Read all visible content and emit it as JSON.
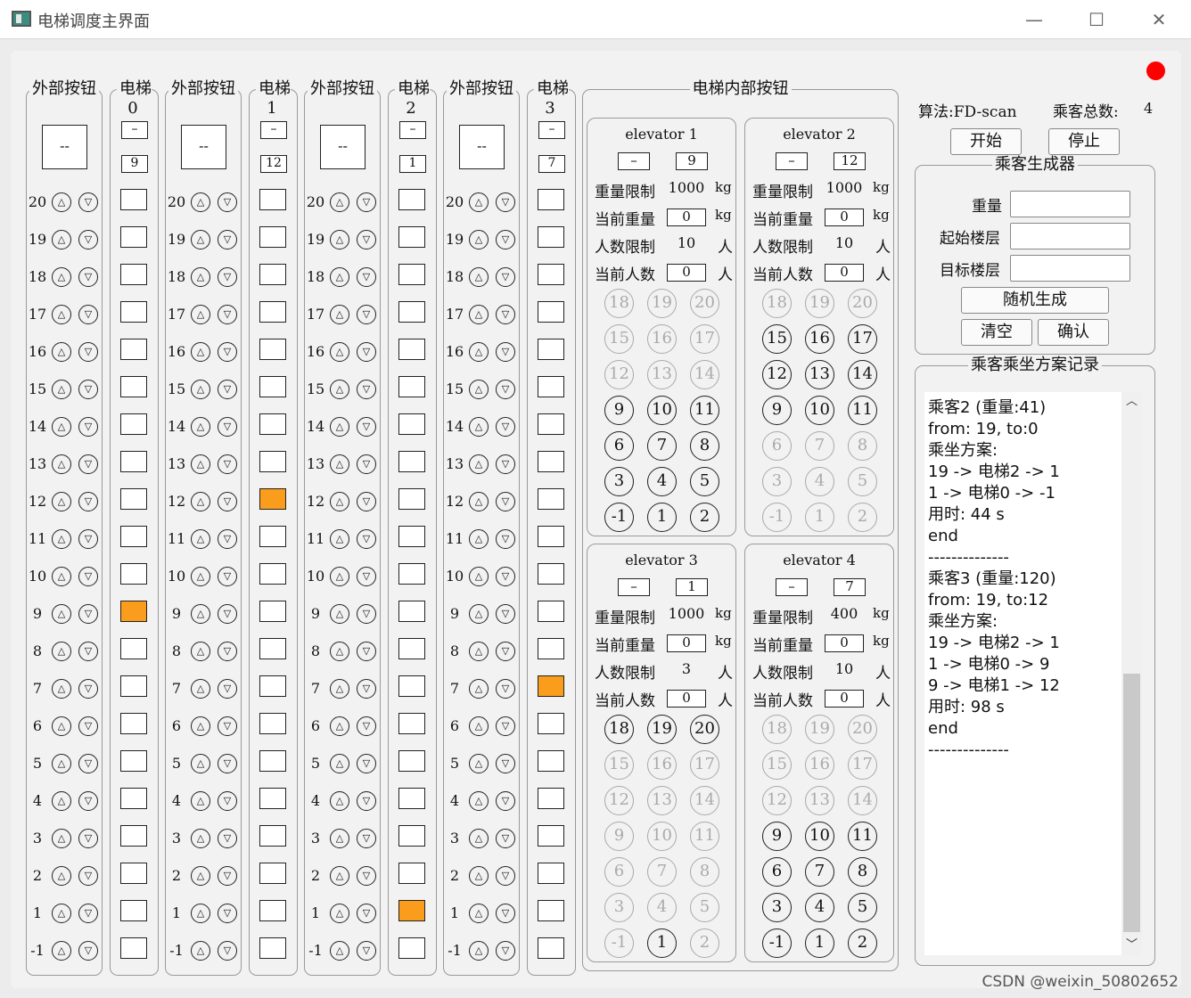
{
  "window": {
    "title": "电梯调度主界面",
    "min": "—",
    "max": "☐",
    "close": "✕"
  },
  "ext_title": "外部按钮",
  "ext_display": "--",
  "floors": [
    "20",
    "19",
    "18",
    "17",
    "16",
    "15",
    "14",
    "13",
    "12",
    "11",
    "10",
    "9",
    "8",
    "7",
    "6",
    "5",
    "4",
    "3",
    "2",
    "1",
    "-1"
  ],
  "shafts": [
    {
      "name": "电梯0",
      "dir": "–",
      "floor": "9",
      "active_index": 11
    },
    {
      "name": "电梯1",
      "dir": "–",
      "floor": "12",
      "active_index": 8
    },
    {
      "name": "电梯2",
      "dir": "–",
      "floor": "1",
      "active_index": 19
    },
    {
      "name": "电梯3",
      "dir": "–",
      "floor": "7",
      "active_index": 13
    }
  ],
  "inner_title": "电梯内部按钮",
  "labels": {
    "weight_limit": "重量限制",
    "cur_weight": "当前重量",
    "people_limit": "人数限制",
    "cur_people": "当前人数",
    "kg": "kg",
    "ren": "人"
  },
  "elevators": [
    {
      "title": "elevator 1",
      "dir": "–",
      "floor": "9",
      "weight_limit": "1000",
      "cur_weight": "0",
      "people_limit": "10",
      "cur_people": "0",
      "enabled": [
        "9",
        "10",
        "11",
        "6",
        "7",
        "8",
        "3",
        "4",
        "5",
        "-1",
        "1",
        "2"
      ]
    },
    {
      "title": "elevator 2",
      "dir": "–",
      "floor": "12",
      "weight_limit": "1000",
      "cur_weight": "0",
      "people_limit": "10",
      "cur_people": "0",
      "enabled": [
        "15",
        "16",
        "17",
        "12",
        "13",
        "14",
        "9",
        "10",
        "11"
      ]
    },
    {
      "title": "elevator 3",
      "dir": "–",
      "floor": "1",
      "weight_limit": "1000",
      "cur_weight": "0",
      "people_limit": "3",
      "cur_people": "0",
      "enabled": [
        "18",
        "19",
        "20",
        "1"
      ]
    },
    {
      "title": "elevator 4",
      "dir": "–",
      "floor": "7",
      "weight_limit": "400",
      "cur_weight": "0",
      "people_limit": "10",
      "cur_people": "0",
      "enabled": [
        "9",
        "10",
        "11",
        "6",
        "7",
        "8",
        "3",
        "4",
        "5",
        "-1",
        "1",
        "2"
      ]
    }
  ],
  "inner_buttons": [
    [
      "18",
      "19",
      "20"
    ],
    [
      "15",
      "16",
      "17"
    ],
    [
      "12",
      "13",
      "14"
    ],
    [
      "9",
      "10",
      "11"
    ],
    [
      "6",
      "7",
      "8"
    ],
    [
      "3",
      "4",
      "5"
    ],
    [
      "-1",
      "1",
      "2"
    ]
  ],
  "right": {
    "algo": "算法:FD-scan",
    "total_label": "乘客总数:",
    "total": "4",
    "start": "开始",
    "stop": "停止",
    "gen_title": "乘客生成器",
    "weight": "重量",
    "from": "起始楼层",
    "to": "目标楼层",
    "random": "随机生成",
    "clear": "清空",
    "confirm": "确认",
    "log_title": "乘客乘坐方案记录"
  },
  "log_lines": [
    "乘客2 (重量:41)",
    "from: 19, to:0",
    "乘坐方案:",
    "19 -> 电梯2 -> 1",
    "1 -> 电梯0 -> -1",
    "用时: 44 s",
    "end",
    "--------------",
    "",
    "乘客3 (重量:120)",
    "from: 19, to:12",
    "乘坐方案:",
    "19 -> 电梯2 -> 1",
    "1 -> 电梯0 -> 9",
    "9 -> 电梯1 -> 12",
    "用时: 98 s",
    "end",
    "--------------"
  ],
  "watermark": "CSDN @weixin_50802652",
  "colors": {
    "active": "#fb9d1c",
    "status": "#ff0000"
  }
}
